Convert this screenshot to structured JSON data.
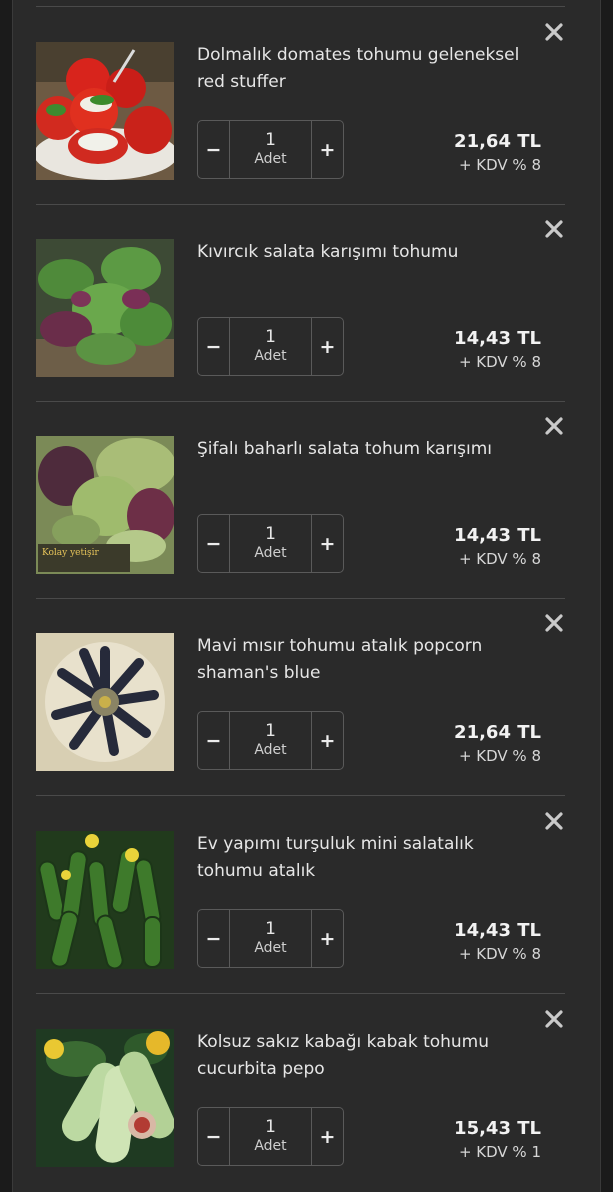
{
  "icons": {
    "remove": "close-icon",
    "decrease": "minus-icon",
    "increase": "plus-icon"
  },
  "colors": {
    "background": "#1b1b1b",
    "panel": "#2a2a2a",
    "divider": "#4a4a4a",
    "text": "#e6e6e6"
  },
  "cart": {
    "items": [
      {
        "title": "Dolmalık domates tohumu geleneksel red stuffer",
        "quantity": "1",
        "unit": "Adet",
        "minus": "−",
        "plus": "+",
        "price": "21,64 TL",
        "vat": "+ KDV % 8",
        "thumb_label": ""
      },
      {
        "title": "Kıvırcık salata karışımı tohumu",
        "quantity": "1",
        "unit": "Adet",
        "minus": "−",
        "plus": "+",
        "price": "14,43 TL",
        "vat": "+ KDV % 8",
        "thumb_label": ""
      },
      {
        "title": "Şifalı baharlı salata tohum karışımı",
        "quantity": "1",
        "unit": "Adet",
        "minus": "−",
        "plus": "+",
        "price": "14,43 TL",
        "vat": "+ KDV % 8",
        "thumb_label": "Kolay yetişir"
      },
      {
        "title": "Mavi mısır tohumu atalık popcorn shaman's blue",
        "quantity": "1",
        "unit": "Adet",
        "minus": "−",
        "plus": "+",
        "price": "21,64 TL",
        "vat": "+ KDV % 8",
        "thumb_label": ""
      },
      {
        "title": "Ev yapımı turşuluk mini salatalık tohumu atalık",
        "quantity": "1",
        "unit": "Adet",
        "minus": "−",
        "plus": "+",
        "price": "14,43 TL",
        "vat": "+ KDV % 8",
        "thumb_label": ""
      },
      {
        "title": "Kolsuz sakız kabağı kabak tohumu cucurbita pepo",
        "quantity": "1",
        "unit": "Adet",
        "minus": "−",
        "plus": "+",
        "price": "15,43 TL",
        "vat": "+ KDV % 1",
        "thumb_label": ""
      }
    ]
  }
}
